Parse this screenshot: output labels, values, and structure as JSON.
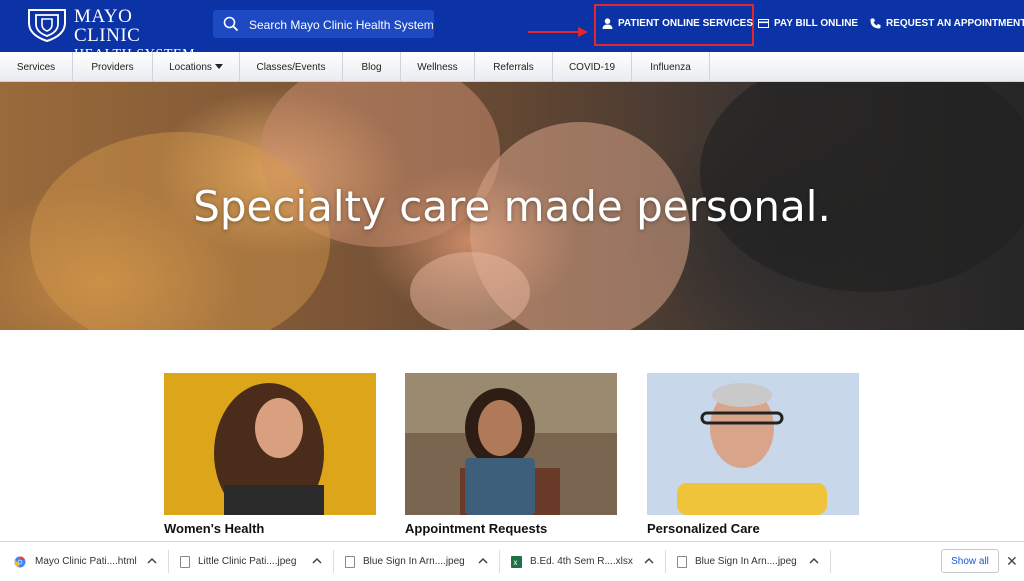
{
  "header": {
    "logo_line1": "MAYO CLINIC",
    "logo_line2": "HEALTH SYSTEM",
    "search_placeholder": "Search Mayo Clinic Health System",
    "utility": {
      "patient_online": "PATIENT ONLINE SERVICES",
      "pay_bill": "PAY BILL ONLINE",
      "request_appt": "REQUEST AN APPOINTMENT"
    },
    "brand_color": "#0b33a6",
    "highlight_color": "#e3262a"
  },
  "nav": {
    "items": [
      {
        "label": "Services"
      },
      {
        "label": "Providers"
      },
      {
        "label": "Locations"
      },
      {
        "label": "Classes/Events"
      },
      {
        "label": "Blog"
      },
      {
        "label": "Wellness"
      },
      {
        "label": "Referrals"
      },
      {
        "label": "COVID-19"
      },
      {
        "label": "Influenza"
      }
    ]
  },
  "hero": {
    "title": "Specialty care made personal."
  },
  "cards": [
    {
      "title": "Women's Health"
    },
    {
      "title": "Appointment Requests"
    },
    {
      "title": "Personalized Care"
    }
  ],
  "downloads": {
    "items": [
      {
        "name": "Mayo Clinic Pati....html",
        "icon": "chrome-file-icon"
      },
      {
        "name": "Little Clinic Pati....jpeg",
        "icon": "image-file-icon"
      },
      {
        "name": "Blue Sign In Arn....jpeg",
        "icon": "image-file-icon"
      },
      {
        "name": "B.Ed. 4th Sem R....xlsx",
        "icon": "excel-file-icon"
      },
      {
        "name": "Blue Sign In Arn....jpeg",
        "icon": "image-file-icon"
      }
    ],
    "show_all": "Show all"
  }
}
